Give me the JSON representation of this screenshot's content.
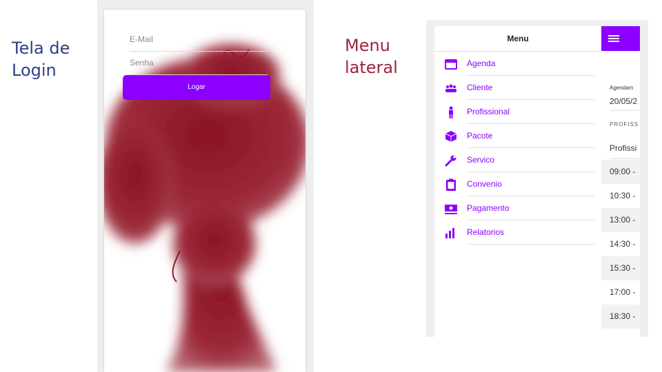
{
  "labels": {
    "login_line1": "Tela de",
    "login_line2": "Login",
    "menu_line1": "Menu",
    "menu_line2": "lateral"
  },
  "login": {
    "email_placeholder": "E-Mail",
    "password_placeholder": "Senha",
    "button_label": "Logar",
    "accent_color": "#8b00ff",
    "silhouette_color": "#8e1a2b"
  },
  "menu": {
    "title": "Menu",
    "items": [
      {
        "label": "Agenda",
        "icon": "calendar-icon"
      },
      {
        "label": "Cliente",
        "icon": "users-icon"
      },
      {
        "label": "Profissional",
        "icon": "person-icon"
      },
      {
        "label": "Pacote",
        "icon": "package-icon"
      },
      {
        "label": "Servico",
        "icon": "wrench-icon"
      },
      {
        "label": "Convenio",
        "icon": "clipboard-icon"
      },
      {
        "label": "Pagamento",
        "icon": "money-icon"
      },
      {
        "label": "Relatorios",
        "icon": "bar-chart-icon"
      }
    ],
    "icon_color": "#8b00ff"
  },
  "content": {
    "agenda_label": "Agendam",
    "date": "20/05/2",
    "profissional_header": "PROFISS",
    "profissional_value": "Profissi",
    "times": [
      "09:00 -",
      "10:30 -",
      "13:00 -",
      "14:30 -",
      "15:30 -",
      "17:00 -",
      "18:30 -"
    ]
  }
}
